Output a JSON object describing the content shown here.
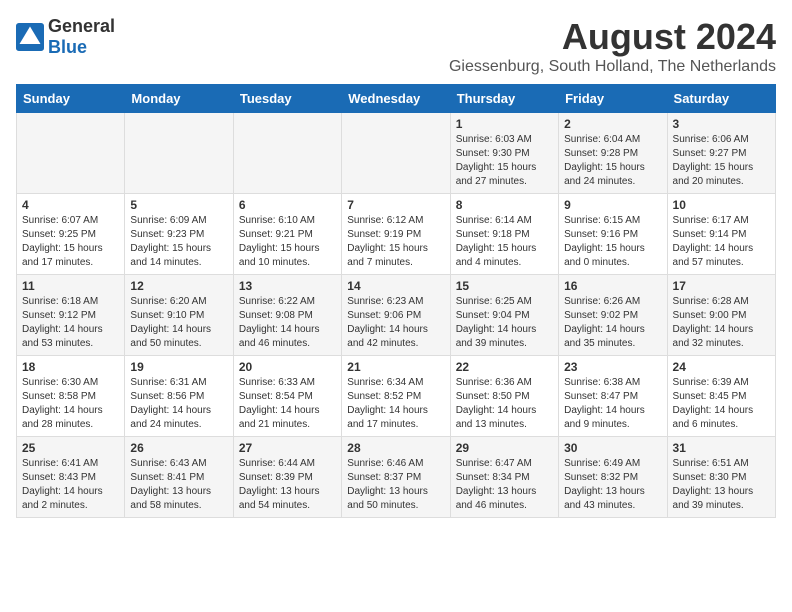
{
  "header": {
    "logo_general": "General",
    "logo_blue": "Blue",
    "month_year": "August 2024",
    "location": "Giessenburg, South Holland, The Netherlands"
  },
  "days_of_week": [
    "Sunday",
    "Monday",
    "Tuesday",
    "Wednesday",
    "Thursday",
    "Friday",
    "Saturday"
  ],
  "weeks": [
    [
      {
        "day": "",
        "content": ""
      },
      {
        "day": "",
        "content": ""
      },
      {
        "day": "",
        "content": ""
      },
      {
        "day": "",
        "content": ""
      },
      {
        "day": "1",
        "content": "Sunrise: 6:03 AM\nSunset: 9:30 PM\nDaylight: 15 hours and 27 minutes."
      },
      {
        "day": "2",
        "content": "Sunrise: 6:04 AM\nSunset: 9:28 PM\nDaylight: 15 hours and 24 minutes."
      },
      {
        "day": "3",
        "content": "Sunrise: 6:06 AM\nSunset: 9:27 PM\nDaylight: 15 hours and 20 minutes."
      }
    ],
    [
      {
        "day": "4",
        "content": "Sunrise: 6:07 AM\nSunset: 9:25 PM\nDaylight: 15 hours and 17 minutes."
      },
      {
        "day": "5",
        "content": "Sunrise: 6:09 AM\nSunset: 9:23 PM\nDaylight: 15 hours and 14 minutes."
      },
      {
        "day": "6",
        "content": "Sunrise: 6:10 AM\nSunset: 9:21 PM\nDaylight: 15 hours and 10 minutes."
      },
      {
        "day": "7",
        "content": "Sunrise: 6:12 AM\nSunset: 9:19 PM\nDaylight: 15 hours and 7 minutes."
      },
      {
        "day": "8",
        "content": "Sunrise: 6:14 AM\nSunset: 9:18 PM\nDaylight: 15 hours and 4 minutes."
      },
      {
        "day": "9",
        "content": "Sunrise: 6:15 AM\nSunset: 9:16 PM\nDaylight: 15 hours and 0 minutes."
      },
      {
        "day": "10",
        "content": "Sunrise: 6:17 AM\nSunset: 9:14 PM\nDaylight: 14 hours and 57 minutes."
      }
    ],
    [
      {
        "day": "11",
        "content": "Sunrise: 6:18 AM\nSunset: 9:12 PM\nDaylight: 14 hours and 53 minutes."
      },
      {
        "day": "12",
        "content": "Sunrise: 6:20 AM\nSunset: 9:10 PM\nDaylight: 14 hours and 50 minutes."
      },
      {
        "day": "13",
        "content": "Sunrise: 6:22 AM\nSunset: 9:08 PM\nDaylight: 14 hours and 46 minutes."
      },
      {
        "day": "14",
        "content": "Sunrise: 6:23 AM\nSunset: 9:06 PM\nDaylight: 14 hours and 42 minutes."
      },
      {
        "day": "15",
        "content": "Sunrise: 6:25 AM\nSunset: 9:04 PM\nDaylight: 14 hours and 39 minutes."
      },
      {
        "day": "16",
        "content": "Sunrise: 6:26 AM\nSunset: 9:02 PM\nDaylight: 14 hours and 35 minutes."
      },
      {
        "day": "17",
        "content": "Sunrise: 6:28 AM\nSunset: 9:00 PM\nDaylight: 14 hours and 32 minutes."
      }
    ],
    [
      {
        "day": "18",
        "content": "Sunrise: 6:30 AM\nSunset: 8:58 PM\nDaylight: 14 hours and 28 minutes."
      },
      {
        "day": "19",
        "content": "Sunrise: 6:31 AM\nSunset: 8:56 PM\nDaylight: 14 hours and 24 minutes."
      },
      {
        "day": "20",
        "content": "Sunrise: 6:33 AM\nSunset: 8:54 PM\nDaylight: 14 hours and 21 minutes."
      },
      {
        "day": "21",
        "content": "Sunrise: 6:34 AM\nSunset: 8:52 PM\nDaylight: 14 hours and 17 minutes."
      },
      {
        "day": "22",
        "content": "Sunrise: 6:36 AM\nSunset: 8:50 PM\nDaylight: 14 hours and 13 minutes."
      },
      {
        "day": "23",
        "content": "Sunrise: 6:38 AM\nSunset: 8:47 PM\nDaylight: 14 hours and 9 minutes."
      },
      {
        "day": "24",
        "content": "Sunrise: 6:39 AM\nSunset: 8:45 PM\nDaylight: 14 hours and 6 minutes."
      }
    ],
    [
      {
        "day": "25",
        "content": "Sunrise: 6:41 AM\nSunset: 8:43 PM\nDaylight: 14 hours and 2 minutes."
      },
      {
        "day": "26",
        "content": "Sunrise: 6:43 AM\nSunset: 8:41 PM\nDaylight: 13 hours and 58 minutes."
      },
      {
        "day": "27",
        "content": "Sunrise: 6:44 AM\nSunset: 8:39 PM\nDaylight: 13 hours and 54 minutes."
      },
      {
        "day": "28",
        "content": "Sunrise: 6:46 AM\nSunset: 8:37 PM\nDaylight: 13 hours and 50 minutes."
      },
      {
        "day": "29",
        "content": "Sunrise: 6:47 AM\nSunset: 8:34 PM\nDaylight: 13 hours and 46 minutes."
      },
      {
        "day": "30",
        "content": "Sunrise: 6:49 AM\nSunset: 8:32 PM\nDaylight: 13 hours and 43 minutes."
      },
      {
        "day": "31",
        "content": "Sunrise: 6:51 AM\nSunset: 8:30 PM\nDaylight: 13 hours and 39 minutes."
      }
    ]
  ]
}
